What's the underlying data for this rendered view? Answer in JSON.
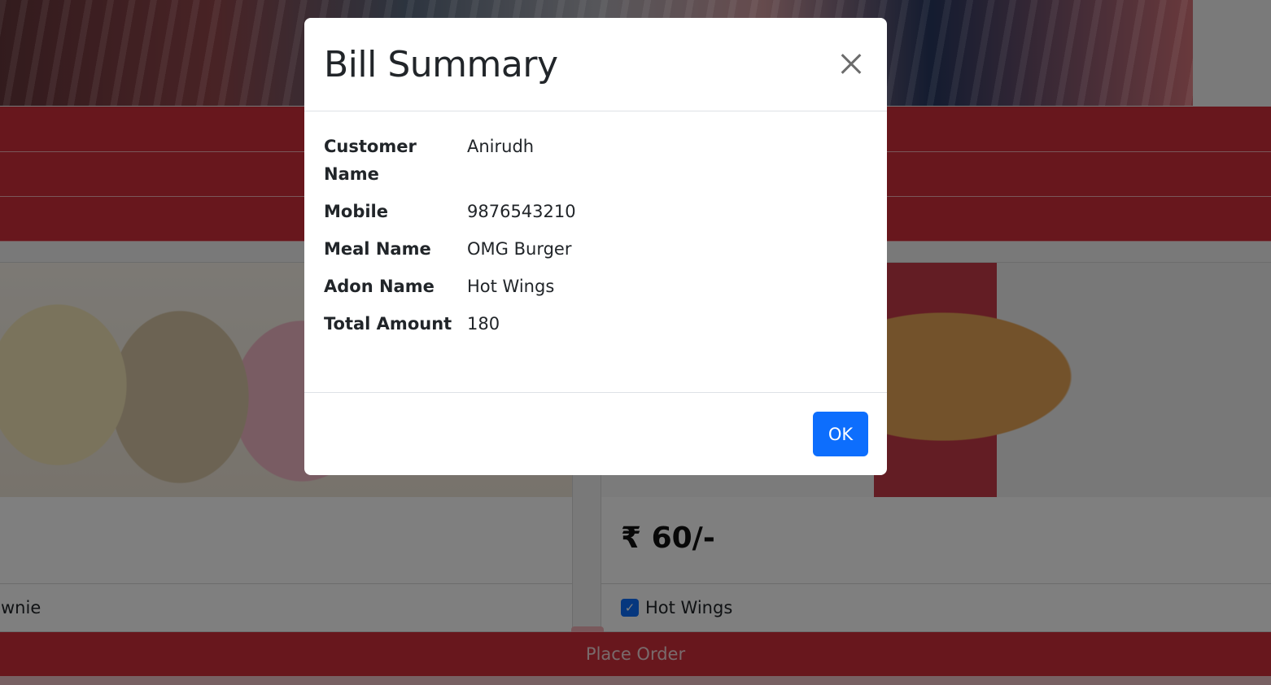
{
  "background": {
    "left_card_addon": "wnie",
    "right_card_price": "₹ 60/-",
    "right_card_addon": "Hot Wings",
    "place_order_label": "Place Order"
  },
  "modal": {
    "title": "Bill Summary",
    "rows": [
      {
        "label": "Customer Name",
        "value": "Anirudh"
      },
      {
        "label": "Mobile",
        "value": "9876543210"
      },
      {
        "label": "Meal Name",
        "value": "OMG Burger"
      },
      {
        "label": "Adon Name",
        "value": "Hot Wings"
      },
      {
        "label": "Total Amount",
        "value": "180"
      }
    ],
    "ok_label": "OK"
  },
  "icons": {
    "close": "close-icon",
    "checkbox": "check-icon"
  },
  "colors": {
    "primary": "#0d6efd",
    "brand_red": "#d12f3b"
  }
}
